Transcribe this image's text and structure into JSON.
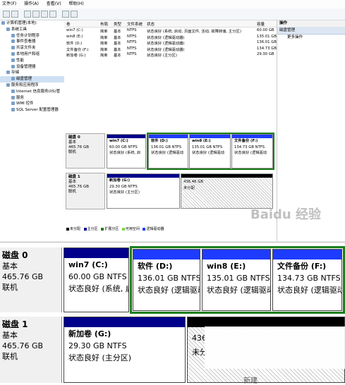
{
  "menu": [
    "文件(F)",
    "操作(A)",
    "查看(V)",
    "帮助(H)"
  ],
  "tree": [
    {
      "label": "计算机管理(本地)",
      "indent": 0
    },
    {
      "label": "系统工具",
      "indent": 1
    },
    {
      "label": "任务计划程序",
      "indent": 2
    },
    {
      "label": "事件查看器",
      "indent": 2
    },
    {
      "label": "共享文件夹",
      "indent": 2
    },
    {
      "label": "本地用户和组",
      "indent": 2
    },
    {
      "label": "性能",
      "indent": 2
    },
    {
      "label": "设备管理器",
      "indent": 2
    },
    {
      "label": "存储",
      "indent": 1
    },
    {
      "label": "磁盘管理",
      "indent": 2
    },
    {
      "label": "服务和应用程序",
      "indent": 1
    },
    {
      "label": "Internet 信息服务(IIS)管",
      "indent": 2
    },
    {
      "label": "服务",
      "indent": 2
    },
    {
      "label": "WMI 控件",
      "indent": 2
    },
    {
      "label": "SQL Server 配置管理器",
      "indent": 2
    }
  ],
  "list": {
    "headers": [
      "卷",
      "布局",
      "类型",
      "文件系统",
      "状态",
      "容量"
    ],
    "rows": [
      {
        "vol": "win7 (C:)",
        "layout": "简单",
        "type": "基本",
        "fs": "NTFS",
        "status": "状态良好 (系统, 启动, 页面文件, 活动, 故障转储, 主分区)",
        "cap": "60.00 GB"
      },
      {
        "vol": "win8 (E:)",
        "layout": "简单",
        "type": "基本",
        "fs": "NTFS",
        "status": "状态良好 (逻辑驱动器)",
        "cap": "135.01 GB"
      },
      {
        "vol": "软件 (D:)",
        "layout": "简单",
        "type": "基本",
        "fs": "NTFS",
        "status": "状态良好 (逻辑驱动器)",
        "cap": "136.01 GB"
      },
      {
        "vol": "文件备份 (F:)",
        "layout": "简单",
        "type": "基本",
        "fs": "NTFS",
        "status": "状态良好 (逻辑驱动器)",
        "cap": "134.73 GB"
      },
      {
        "vol": "新加卷 (G:)",
        "layout": "简单",
        "type": "基本",
        "fs": "NTFS",
        "status": "状态良好 (主分区)",
        "cap": "29.30 GB"
      }
    ]
  },
  "actions": {
    "title": "操作",
    "selected": "磁盘管理",
    "more": "更多操作"
  },
  "disks": [
    {
      "name": "磁盘 0",
      "type": "基本",
      "size": "465.76 GB",
      "state": "联机"
    },
    {
      "name": "磁盘 1",
      "type": "基本",
      "size": "465.76 GB",
      "state": "联机"
    }
  ],
  "disk0_vols": [
    {
      "name": "win7  (C:)",
      "size": "60.00 GB NTFS",
      "status": "状态良好 (系统, 启"
    },
    {
      "name": "软件  (D:)",
      "size": "136.01 GB NTFS",
      "status": "状态良好 (逻辑驱动"
    },
    {
      "name": "win8  (E:)",
      "size": "135.01 GB NTFS",
      "status": "状态良好 (逻辑驱动"
    },
    {
      "name": "文件备份  (F:)",
      "size": "134.73 GB NTFS",
      "status": "状态良好 (逻辑驱动"
    }
  ],
  "disk1_vols": [
    {
      "name": "新加卷  (G:)",
      "size": "29.30 GB NTFS",
      "status": "状态良好 (主分区)"
    },
    {
      "name": "",
      "size": "436.46 GB",
      "status": "未分配"
    }
  ],
  "zoom_disk1_unalloc": {
    "size": "436",
    "status": "未分"
  },
  "legend": [
    "未分配",
    "主分区",
    "扩展分区",
    "可用空间",
    "逻辑驱动器"
  ],
  "colors": {
    "primary": "#00008b",
    "logical": "#1e3cff",
    "extended": "#1a7f1a",
    "free": "#7fd34a",
    "unallocated": "#000000"
  },
  "watermark": "Baidu 经验",
  "zoom_bottom_text": "新建"
}
